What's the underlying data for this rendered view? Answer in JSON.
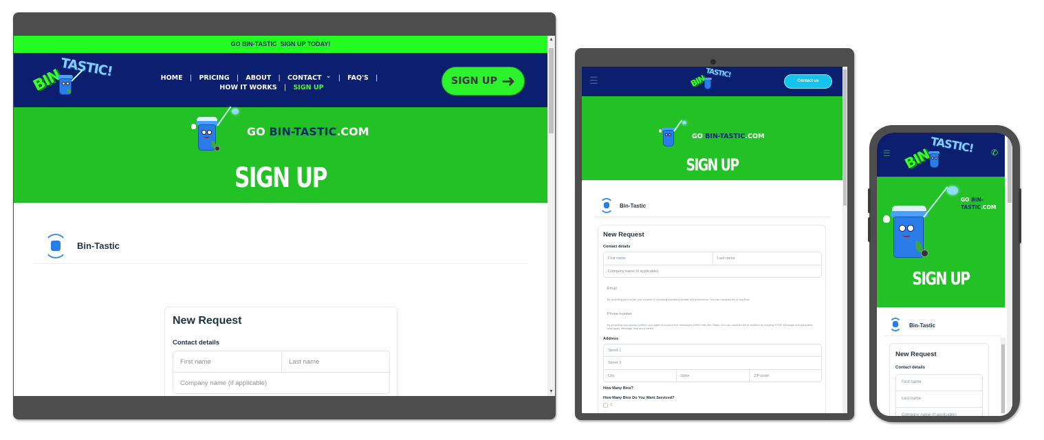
{
  "site": {
    "announcement": "GO BIN-TASTIC  SIGN UP TODAY!",
    "logo_text_part1": "BIN",
    "logo_text_part2": "TASTIC!",
    "nav": {
      "items": [
        "HOME",
        "PRICING",
        "ABOUT",
        "CONTACT",
        "FAQ'S",
        "HOW IT WORKS",
        "SIGN UP"
      ],
      "separator": "|",
      "active": "SIGN UP"
    },
    "cta_button": "SIGN UP",
    "tablet_cta_button": "Contact us",
    "hero": {
      "tag_prefix": "GO ",
      "tag_brand": "BIN-TASTIC",
      "tag_suffix": ".COM",
      "phone_tag_brand_line1": "BIN-",
      "phone_tag_brand_line2": "TASTIC",
      "title": "SIGN UP"
    },
    "colors": {
      "announce_bg": "#22fc22",
      "nav_bg": "#0b1f6e",
      "hero_bg": "#22c126",
      "cta_bg": "#2bf22b",
      "tablet_cta_bg": "#13c3ee",
      "active_nav": "#3bff2a"
    }
  },
  "form": {
    "business_name": "Bin-Tastic",
    "title": "New Request",
    "contact_section": "Contact details",
    "placeholders": {
      "first_name": "First name",
      "last_name": "Last name",
      "company": "Company name (if applicable)",
      "email": "Email",
      "phone": "Phone number",
      "street1": "Street 1",
      "street2": "Street 2",
      "city": "City",
      "state": "State",
      "zip": "ZIP code"
    },
    "email_hint": "By providing your email, you consent to receiving marketing emails and promotions. You can unsubscribe at any time.",
    "phone_hint": "By providing your phone number, you agree to receive text messages (SMS) from Bin-Tastic. You can unsubscribe at anytime by replying STOP. Message and data rates may apply. Message frequency varies.",
    "address_section": "Address",
    "bins_section": "How Many Bins?",
    "bins_question": "How Many Bins Do You Want Serviced?",
    "bins_options": [
      "1"
    ]
  },
  "icons": {
    "arrow_right": "➜",
    "chevron_down": "⌄",
    "hamburger": "☰",
    "phone": "✆",
    "scroll_up": "▲",
    "scroll_down": "▼"
  }
}
